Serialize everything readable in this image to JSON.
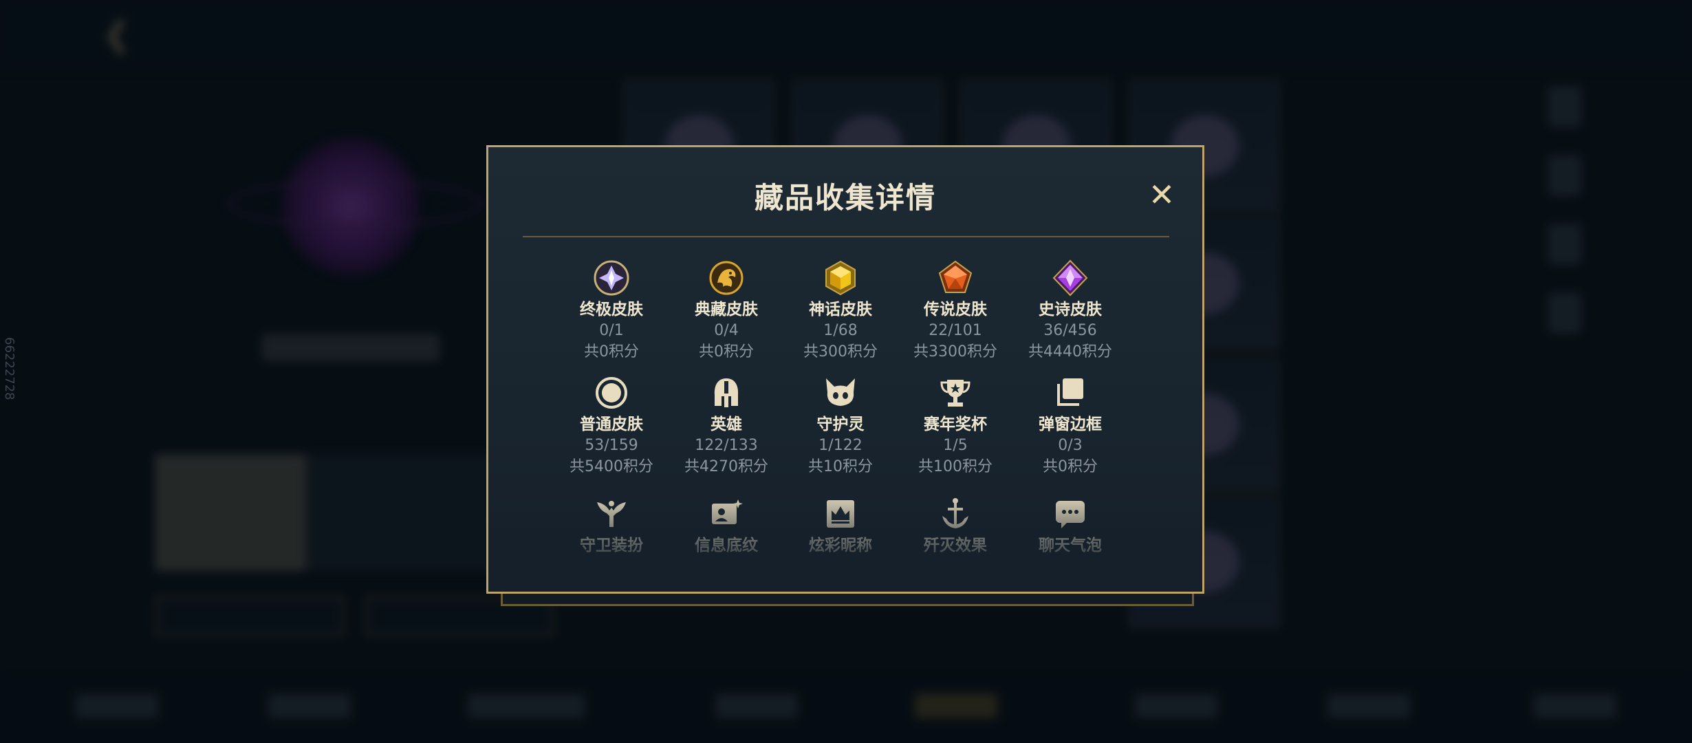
{
  "modal": {
    "title": "藏品收集详情",
    "close_label": "✕"
  },
  "side_code": "66222728",
  "categories": [
    {
      "label": "终极皮肤",
      "count": "0/1",
      "points": "共0积分",
      "icon": "ultimate-gem-icon",
      "color": "#b9a6f5"
    },
    {
      "label": "典藏皮肤",
      "count": "0/4",
      "points": "共0积分",
      "icon": "prestige-dragon-icon",
      "color": "#e0a92a"
    },
    {
      "label": "神话皮肤",
      "count": "1/68",
      "points": "共300积分",
      "icon": "mythic-gem-icon",
      "color": "#e8b816"
    },
    {
      "label": "传说皮肤",
      "count": "22/101",
      "points": "共3300积分",
      "icon": "legendary-gem-icon",
      "color": "#e26a1e"
    },
    {
      "label": "史诗皮肤",
      "count": "36/456",
      "points": "共4440积分",
      "icon": "epic-gem-icon",
      "color": "#a236d6"
    },
    {
      "label": "普通皮肤",
      "count": "53/159",
      "points": "共5400积分",
      "icon": "normal-skin-icon",
      "color": "#e8dcc0"
    },
    {
      "label": "英雄",
      "count": "122/133",
      "points": "共4270积分",
      "icon": "champion-helmet-icon",
      "color": "#e8dcc0"
    },
    {
      "label": "守护灵",
      "count": "1/122",
      "points": "共10积分",
      "icon": "guardian-spirit-icon",
      "color": "#e8dcc0"
    },
    {
      "label": "赛年奖杯",
      "count": "1/5",
      "points": "共100积分",
      "icon": "trophy-icon",
      "color": "#e8dcc0"
    },
    {
      "label": "弹窗边框",
      "count": "0/3",
      "points": "共0积分",
      "icon": "popup-frame-icon",
      "color": "#e8dcc0"
    },
    {
      "label": "守卫装扮",
      "icon": "ward-skin-icon",
      "color": "#e8dcc0"
    },
    {
      "label": "信息底纹",
      "icon": "info-card-icon",
      "color": "#e8dcc0"
    },
    {
      "label": "炫彩昵称",
      "icon": "colorful-name-icon",
      "color": "#e8dcc0"
    },
    {
      "label": "歼灭效果",
      "icon": "kill-effect-icon",
      "color": "#e8dcc0"
    },
    {
      "label": "聊天气泡",
      "icon": "chat-bubble-icon",
      "color": "#e8dcc0"
    }
  ]
}
